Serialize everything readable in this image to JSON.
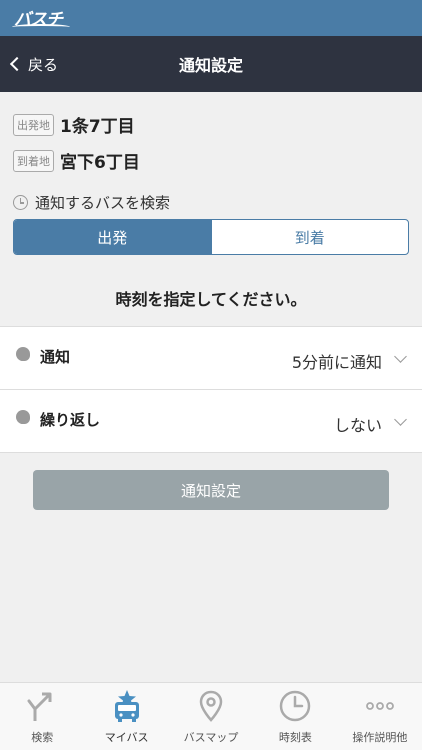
{
  "brand": {
    "logo_text": "バスチカ"
  },
  "nav": {
    "back_label": "戻る",
    "title": "通知設定"
  },
  "departure": {
    "tag": "出発地",
    "name": "1条7丁目"
  },
  "arrival": {
    "tag": "到着地",
    "name": "宮下6丁目"
  },
  "search": {
    "label": "通知するバスを検索",
    "options": [
      "出発",
      "到着"
    ],
    "selected": "出発"
  },
  "prompt": "時刻を指定してください。",
  "settings": [
    {
      "label": "通知",
      "value": "5分前に通知"
    },
    {
      "label": "繰り返し",
      "value": "しない"
    }
  ],
  "submit_label": "通知設定",
  "tabs": [
    {
      "label": "検索",
      "icon": "route-icon",
      "active": false
    },
    {
      "label": "マイバス",
      "icon": "my-bus-icon",
      "active": true
    },
    {
      "label": "バスマップ",
      "icon": "map-pin-icon",
      "active": false
    },
    {
      "label": "時刻表",
      "icon": "clock-icon",
      "active": false
    },
    {
      "label": "操作説明他",
      "icon": "more-icon",
      "active": false
    }
  ],
  "colors": {
    "accent": "#4a7ca6",
    "navbar": "#2e3340",
    "disabled_button": "#99a4a8"
  }
}
